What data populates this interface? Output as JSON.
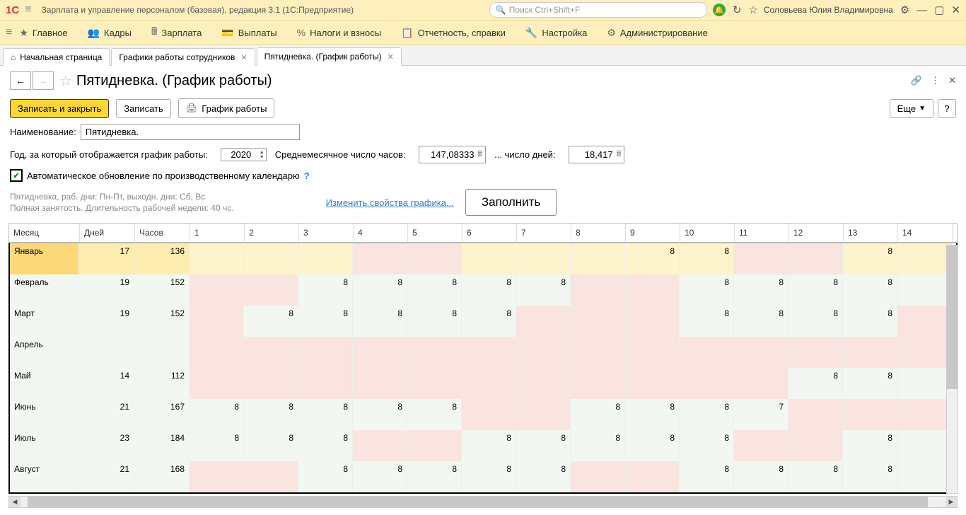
{
  "app": {
    "title": "Зарплата и управление персоналом (базовая), редакция 3.1  (1С:Предприятие)",
    "search_placeholder": "Поиск Ctrl+Shift+F",
    "user": "Соловьева Юлия Владимировна"
  },
  "menu": {
    "main": "Главное",
    "kadry": "Кадры",
    "zarplata": "Зарплата",
    "vyplaty": "Выплаты",
    "nalogi": "Налоги и взносы",
    "otchet": "Отчетность, справки",
    "nastroika": "Настройка",
    "admin": "Администрирование"
  },
  "tabs": {
    "start": "Начальная страница",
    "schedules": "Графики работы сотрудников",
    "current": "Пятидневка. (График работы)"
  },
  "page": {
    "title": "Пятидневка. (График работы)",
    "save_close": "Записать и закрыть",
    "save": "Записать",
    "print": "График работы",
    "more": "Еще",
    "help": "?"
  },
  "form": {
    "name_lbl": "Наименование:",
    "name_val": "Пятидневка.",
    "year_lbl": "Год, за который отображается график работы:",
    "year_val": "2020",
    "avg_hours_lbl": "Среднемесячное число часов:",
    "avg_hours_val": "147,08333",
    "avg_days_lbl": "... число дней:",
    "avg_days_val": "18,417",
    "auto_update": "Автоматическое обновление по производственному календарю",
    "info1": "Пятидневка, раб. дни: Пн-Пт, выходн. дни: Сб, Вс",
    "info2": "Полная занятость. Длительность рабочей недели: 40 чс.",
    "edit_link": "Изменить свойства графика...",
    "fill": "Заполнить"
  },
  "grid": {
    "cols": {
      "month": "Месяц",
      "days": "Дней",
      "hours": "Часов"
    },
    "day_nums": [
      "1",
      "2",
      "3",
      "4",
      "5",
      "6",
      "7",
      "8",
      "9",
      "10",
      "11",
      "12",
      "13",
      "14"
    ],
    "rows": [
      {
        "m": "Январь",
        "d": "17",
        "h": "136",
        "cells": [
          {
            "v": "",
            "c": "yellowlt"
          },
          {
            "v": "",
            "c": "yellowlt"
          },
          {
            "v": "",
            "c": "yellowlt"
          },
          {
            "v": "",
            "c": "pink"
          },
          {
            "v": "",
            "c": "pink"
          },
          {
            "v": "",
            "c": "yellowlt"
          },
          {
            "v": "",
            "c": "yellowlt"
          },
          {
            "v": "",
            "c": "yellowlt"
          },
          {
            "v": "8",
            "c": "yellowlt"
          },
          {
            "v": "8",
            "c": "yellowlt"
          },
          {
            "v": "",
            "c": "pink"
          },
          {
            "v": "",
            "c": "pink"
          },
          {
            "v": "8",
            "c": "yellowlt"
          },
          {
            "v": "",
            "c": "yellowlt"
          }
        ],
        "sel": true
      },
      {
        "m": "Февраль",
        "d": "19",
        "h": "152",
        "cells": [
          {
            "v": "",
            "c": "pink"
          },
          {
            "v": "",
            "c": "pink"
          },
          {
            "v": "8",
            "c": "green"
          },
          {
            "v": "8",
            "c": "green"
          },
          {
            "v": "8",
            "c": "green"
          },
          {
            "v": "8",
            "c": "green"
          },
          {
            "v": "8",
            "c": "green"
          },
          {
            "v": "",
            "c": "pink"
          },
          {
            "v": "",
            "c": "pink"
          },
          {
            "v": "8",
            "c": "green"
          },
          {
            "v": "8",
            "c": "green"
          },
          {
            "v": "8",
            "c": "green"
          },
          {
            "v": "8",
            "c": "green"
          },
          {
            "v": "",
            "c": "green"
          }
        ]
      },
      {
        "m": "Март",
        "d": "19",
        "h": "152",
        "cells": [
          {
            "v": "",
            "c": "pink"
          },
          {
            "v": "8",
            "c": "green"
          },
          {
            "v": "8",
            "c": "green"
          },
          {
            "v": "8",
            "c": "green"
          },
          {
            "v": "8",
            "c": "green"
          },
          {
            "v": "8",
            "c": "green"
          },
          {
            "v": "",
            "c": "pink"
          },
          {
            "v": "",
            "c": "pink"
          },
          {
            "v": "",
            "c": "pink"
          },
          {
            "v": "8",
            "c": "green"
          },
          {
            "v": "8",
            "c": "green"
          },
          {
            "v": "8",
            "c": "green"
          },
          {
            "v": "8",
            "c": "green"
          },
          {
            "v": "",
            "c": "pink"
          }
        ]
      },
      {
        "m": "Апрель",
        "d": "",
        "h": "",
        "cells": [
          {
            "v": "",
            "c": "pink"
          },
          {
            "v": "",
            "c": "pink"
          },
          {
            "v": "",
            "c": "pink"
          },
          {
            "v": "",
            "c": "pink"
          },
          {
            "v": "",
            "c": "pink"
          },
          {
            "v": "",
            "c": "pink"
          },
          {
            "v": "",
            "c": "pink"
          },
          {
            "v": "",
            "c": "pink"
          },
          {
            "v": "",
            "c": "pink"
          },
          {
            "v": "",
            "c": "pink"
          },
          {
            "v": "",
            "c": "pink"
          },
          {
            "v": "",
            "c": "pink"
          },
          {
            "v": "",
            "c": "pink"
          },
          {
            "v": "",
            "c": "pink"
          }
        ]
      },
      {
        "m": "Май",
        "d": "14",
        "h": "112",
        "cells": [
          {
            "v": "",
            "c": "pink"
          },
          {
            "v": "",
            "c": "pink"
          },
          {
            "v": "",
            "c": "pink"
          },
          {
            "v": "",
            "c": "pink"
          },
          {
            "v": "",
            "c": "pink"
          },
          {
            "v": "",
            "c": "pink"
          },
          {
            "v": "",
            "c": "pink"
          },
          {
            "v": "",
            "c": "pink"
          },
          {
            "v": "",
            "c": "pink"
          },
          {
            "v": "",
            "c": "pink"
          },
          {
            "v": "",
            "c": "pink"
          },
          {
            "v": "8",
            "c": "green"
          },
          {
            "v": "8",
            "c": "green"
          },
          {
            "v": "",
            "c": "green"
          }
        ]
      },
      {
        "m": "Июнь",
        "d": "21",
        "h": "167",
        "cells": [
          {
            "v": "8",
            "c": "green"
          },
          {
            "v": "8",
            "c": "green"
          },
          {
            "v": "8",
            "c": "green"
          },
          {
            "v": "8",
            "c": "green"
          },
          {
            "v": "8",
            "c": "green"
          },
          {
            "v": "",
            "c": "pink"
          },
          {
            "v": "",
            "c": "pink"
          },
          {
            "v": "8",
            "c": "green"
          },
          {
            "v": "8",
            "c": "green"
          },
          {
            "v": "8",
            "c": "green"
          },
          {
            "v": "7",
            "c": "green"
          },
          {
            "v": "",
            "c": "pink"
          },
          {
            "v": "",
            "c": "pink"
          },
          {
            "v": "",
            "c": "pink"
          }
        ]
      },
      {
        "m": "Июль",
        "d": "23",
        "h": "184",
        "cells": [
          {
            "v": "8",
            "c": "green"
          },
          {
            "v": "8",
            "c": "green"
          },
          {
            "v": "8",
            "c": "green"
          },
          {
            "v": "",
            "c": "pink"
          },
          {
            "v": "",
            "c": "pink"
          },
          {
            "v": "8",
            "c": "green"
          },
          {
            "v": "8",
            "c": "green"
          },
          {
            "v": "8",
            "c": "green"
          },
          {
            "v": "8",
            "c": "green"
          },
          {
            "v": "8",
            "c": "green"
          },
          {
            "v": "",
            "c": "pink"
          },
          {
            "v": "",
            "c": "pink"
          },
          {
            "v": "8",
            "c": "green"
          },
          {
            "v": "",
            "c": "green"
          }
        ]
      },
      {
        "m": "Август",
        "d": "21",
        "h": "168",
        "cells": [
          {
            "v": "",
            "c": "pink"
          },
          {
            "v": "",
            "c": "pink"
          },
          {
            "v": "8",
            "c": "green"
          },
          {
            "v": "8",
            "c": "green"
          },
          {
            "v": "8",
            "c": "green"
          },
          {
            "v": "8",
            "c": "green"
          },
          {
            "v": "8",
            "c": "green"
          },
          {
            "v": "",
            "c": "pink"
          },
          {
            "v": "",
            "c": "pink"
          },
          {
            "v": "8",
            "c": "green"
          },
          {
            "v": "8",
            "c": "green"
          },
          {
            "v": "8",
            "c": "green"
          },
          {
            "v": "8",
            "c": "green"
          },
          {
            "v": "",
            "c": "green"
          }
        ]
      }
    ]
  }
}
